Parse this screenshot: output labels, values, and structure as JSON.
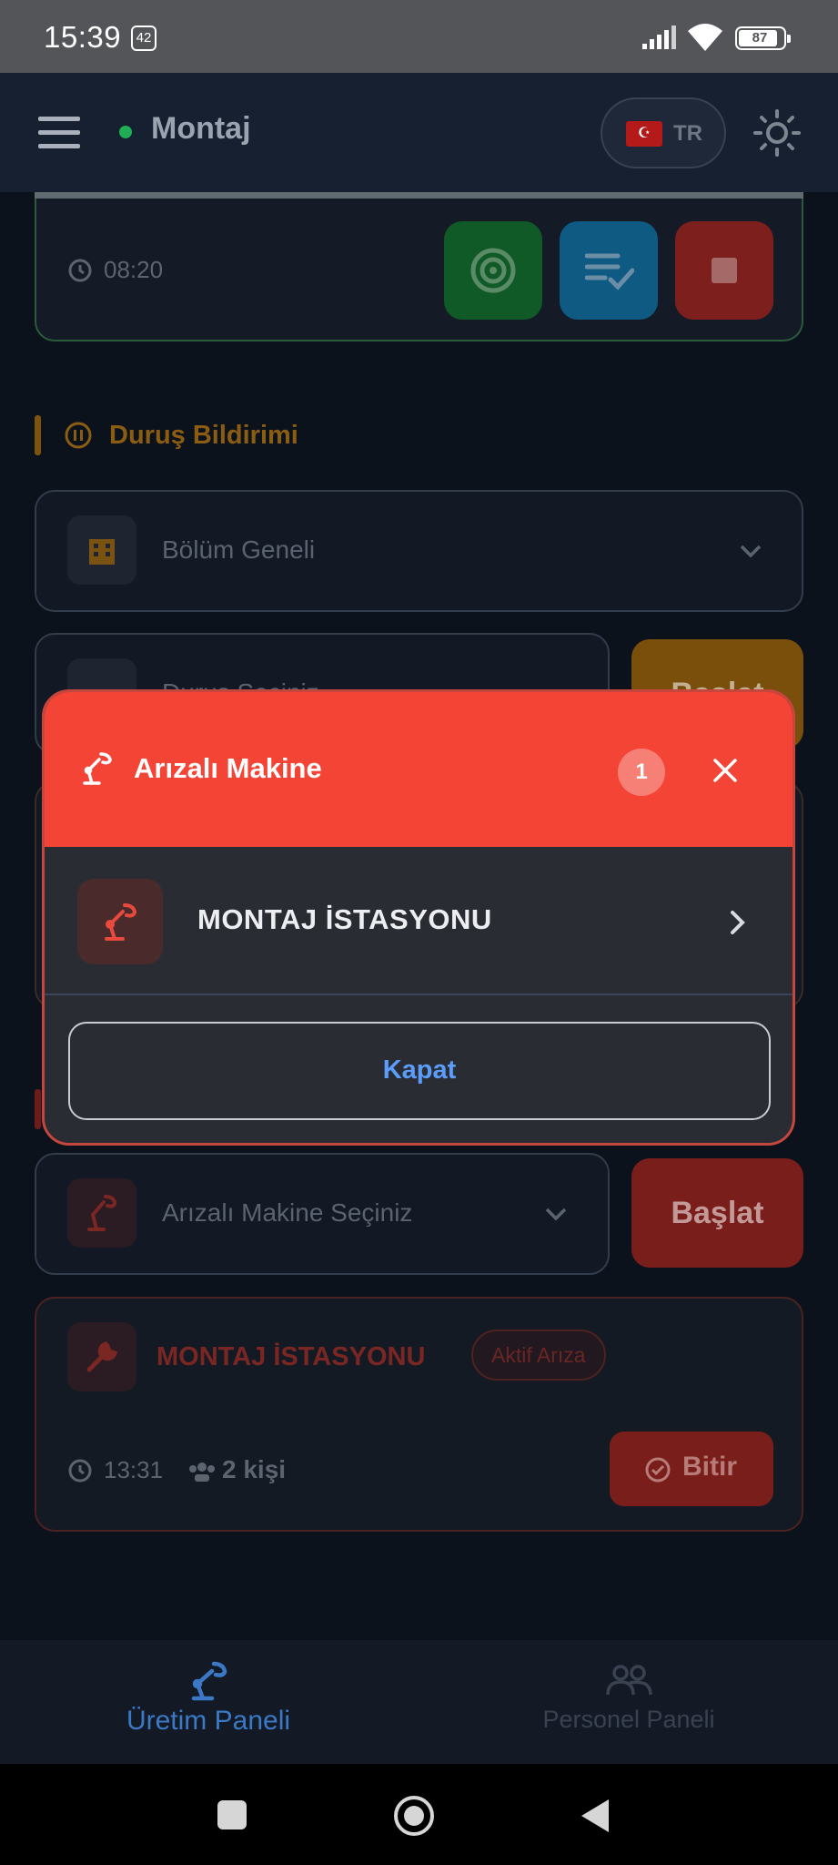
{
  "status_bar": {
    "time": "15:39",
    "notification_count": "42",
    "battery": "87"
  },
  "app_bar": {
    "title": "Montaj",
    "language": "TR",
    "status_dot_color": "#1fae55"
  },
  "top_card": {
    "time": "08:20",
    "buttons": [
      "radar-icon",
      "checklist-icon",
      "stop-icon"
    ]
  },
  "stop_report": {
    "title": "Duruş Bildirimi",
    "department_select": "Bölüm Geneli",
    "reason_select": "Duruş Seçiniz",
    "start_label": "Başlat"
  },
  "fault_section": {
    "machine_select": "Arızalı Makine Seçiniz",
    "start_label": "Başlat",
    "active": {
      "name": "MONTAJ İSTASYONU",
      "badge": "Aktif Arıza",
      "time": "13:31",
      "people": "2 kişi",
      "finish_label": "Bitir"
    }
  },
  "dialog": {
    "title": "Arızalı Makine",
    "count": "1",
    "items": [
      {
        "name": "MONTAJ İSTASYONU"
      }
    ],
    "close_label": "Kapat",
    "header_color": "#f34436"
  },
  "bottom_nav": {
    "items": [
      {
        "label": "Üretim Paneli",
        "active": true
      },
      {
        "label": "Personel Paneli",
        "active": false
      }
    ]
  }
}
